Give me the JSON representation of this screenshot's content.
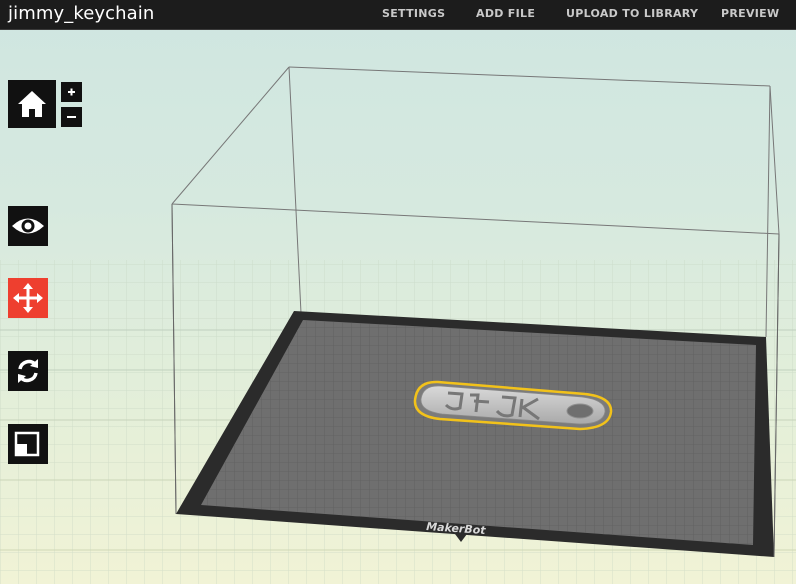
{
  "window": {
    "title": "jimmy_keychain"
  },
  "menu": {
    "settings": "SETTINGS",
    "add_file": "ADD FILE",
    "upload": "UPLOAD TO LIBRARY",
    "preview": "PREVIEW"
  },
  "toolbar": {
    "zoom_in": "+",
    "zoom_out": "−"
  },
  "build_plate": {
    "brand_label": "MakerBot"
  },
  "icons": {
    "home": "home-icon",
    "view": "eye-icon",
    "move": "move-arrows-icon",
    "rotate": "rotate-icon",
    "scale": "scale-icon"
  },
  "colors": {
    "topbar": "#1c1c1c",
    "active_tool": "#ee3f2f",
    "selection_outline": "#f2c21a",
    "plate": "#6f6f6f",
    "plate_border": "#2a2a2a"
  }
}
